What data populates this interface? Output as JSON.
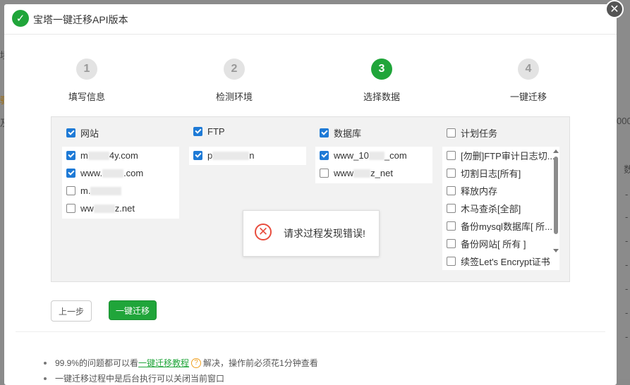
{
  "dialog": {
    "title": "宝塔一键迁移API版本",
    "close": "✕"
  },
  "background": {
    "left_chars": [
      "境",
      "骤",
      "及"
    ],
    "right_chars": [
      "000",
      "数"
    ],
    "dashes": [
      "-",
      "-",
      "-",
      "-",
      "-",
      "-",
      "-"
    ]
  },
  "steps": [
    {
      "num": "1",
      "label": "填写信息",
      "active": false
    },
    {
      "num": "2",
      "label": "检测环境",
      "active": false
    },
    {
      "num": "3",
      "label": "选择数据",
      "active": true
    },
    {
      "num": "4",
      "label": "一键迁移",
      "active": false
    }
  ],
  "columns": {
    "sites": {
      "label": "网站",
      "checked": true,
      "items": [
        {
          "pre": "m",
          "post": "4y.com",
          "checked": true
        },
        {
          "pre": "www.",
          "post": ".com",
          "checked": true
        },
        {
          "pre": "m.",
          "post": "",
          "checked": false
        },
        {
          "pre": "ww",
          "post": "z.net",
          "checked": false
        }
      ]
    },
    "ftp": {
      "label": "FTP",
      "checked": true,
      "items": [
        {
          "pre": "p",
          "post": "n",
          "checked": true
        }
      ]
    },
    "databases": {
      "label": "数据库",
      "checked": true,
      "items": [
        {
          "pre": "www_10",
          "post": "_com",
          "checked": true
        },
        {
          "pre": "www",
          "post": "z_net",
          "checked": false
        }
      ]
    },
    "tasks": {
      "label": "计划任务",
      "checked": false,
      "items": [
        {
          "text": "[勿删]FTP审计日志切...",
          "checked": false
        },
        {
          "text": "切割日志[所有]",
          "checked": false
        },
        {
          "text": "释放内存",
          "checked": false
        },
        {
          "text": "木马查杀[全部]",
          "checked": false
        },
        {
          "text": "备份mysql数据库[ 所...",
          "checked": false
        },
        {
          "text": "备份网站[ 所有 ]",
          "checked": false
        },
        {
          "text": "续签Let's Encrypt证书",
          "checked": false
        }
      ]
    }
  },
  "error": {
    "icon": "✕",
    "message": "请求过程发现错误!"
  },
  "buttons": {
    "prev": "上一步",
    "migrate": "一键迁移"
  },
  "tips": [
    {
      "before": "99.9%的问题都可以看",
      "link": "一键迁移教程",
      "q": "?",
      "after": "解决，操作前必须花1分钟查看"
    },
    {
      "before": "一键迁移过程中是后台执行可以关闭当前窗口",
      "link": "",
      "q": "",
      "after": ""
    }
  ]
}
